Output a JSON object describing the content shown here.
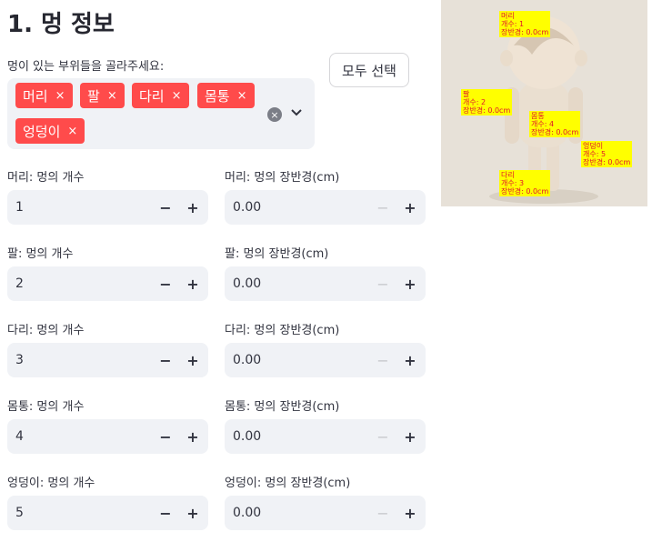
{
  "title": "1. 멍 정보",
  "multiselect": {
    "label": "멍이 있는 부위들을 골라주세요:",
    "selected": [
      "머리",
      "팔",
      "다리",
      "몸통",
      "엉덩이"
    ]
  },
  "select_all_label": "모두 선택",
  "rows": [
    {
      "count_label": "머리: 멍의 개수",
      "count": "1",
      "size_label": "머리: 멍의 장반경(cm)",
      "size": "0.00"
    },
    {
      "count_label": "팔: 멍의 개수",
      "count": "2",
      "size_label": "팔: 멍의 장반경(cm)",
      "size": "0.00"
    },
    {
      "count_label": "다리: 멍의 개수",
      "count": "3",
      "size_label": "다리: 멍의 장반경(cm)",
      "size": "0.00"
    },
    {
      "count_label": "몸통: 멍의 개수",
      "count": "4",
      "size_label": "몸통: 멍의 장반경(cm)",
      "size": "0.00"
    },
    {
      "count_label": "엉덩이: 멍의 개수",
      "count": "5",
      "size_label": "엉덩이: 멍의 장반경(cm)",
      "size": "0.00"
    }
  ],
  "figure": {
    "annotations": [
      {
        "part": "머리",
        "count": "개수: 1",
        "size": "장반경: 0.0cm"
      },
      {
        "part": "팔",
        "count": "개수: 2",
        "size": "장반경: 0.0cm"
      },
      {
        "part": "몸통",
        "count": "개수: 4",
        "size": "장반경: 0.0cm"
      },
      {
        "part": "엉덩이",
        "count": "개수: 5",
        "size": "장반경: 0.0cm"
      },
      {
        "part": "다리",
        "count": "개수: 3",
        "size": "장반경: 0.0cm"
      }
    ]
  },
  "icons": {
    "tag_remove": "×",
    "clear": "×",
    "minus": "−",
    "plus": "+"
  },
  "colors": {
    "tag_bg": "#ff4b4b",
    "input_bg": "#f0f2f6",
    "annotation_bg": "#ffff00",
    "annotation_text": "#e0142c"
  }
}
